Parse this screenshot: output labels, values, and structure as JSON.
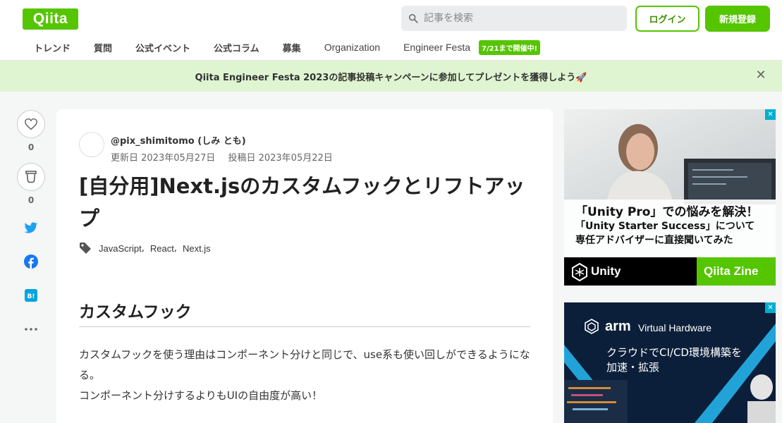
{
  "header": {
    "logo": "Qiita",
    "search_placeholder": "記事を検索",
    "login": "ログイン",
    "signup": "新規登録"
  },
  "nav": {
    "items": [
      "トレンド",
      "質問",
      "公式イベント",
      "公式コラム",
      "募集",
      "Organization",
      "Engineer Festa"
    ],
    "badge": "7/21まで開催中!"
  },
  "banner": {
    "text": "Qiita Engineer Festa 2023の記事投稿キャンペーンに参加してプレゼントを獲得しよう🚀"
  },
  "rail": {
    "like_count": "0",
    "stock_count": "0"
  },
  "article": {
    "author": "@pix_shimitomo (しみ とも)",
    "updated": "更新日 2023年05月27日",
    "posted": "投稿日 2023年05月22日",
    "title": "[自分用]Next.jsのカスタムフックとリフトアップ",
    "tags": [
      "JavaScript",
      "React",
      "Next.js"
    ],
    "heading": "カスタムフック",
    "paragraphs": [
      "カスタムフックを使う理由はコンポーネント分けと同じで、use系も使い回しができるようになる。",
      "コンポーネント分けするよりもUIの自由度が高い！"
    ]
  },
  "ads": {
    "ad1": {
      "line1": "「Unity Pro」での悩みを解決！",
      "line2": "「Unity Starter Success」について",
      "line3": "専任アドバイザーに直接聞いてみた",
      "brand_left": "Unity",
      "brand_right": "Qiita Zine"
    },
    "ad2": {
      "brand": "arm",
      "brand_sub": "Virtual Hardware",
      "line1": "クラウドでCI/CD環境構築を",
      "line2": "加速・拡張"
    }
  },
  "colors": {
    "brand_green": "#55c500",
    "banner_bg": "#dff5d1",
    "twitter": "#1da1f2",
    "facebook": "#1877f2",
    "hatena": "#00a4de"
  }
}
